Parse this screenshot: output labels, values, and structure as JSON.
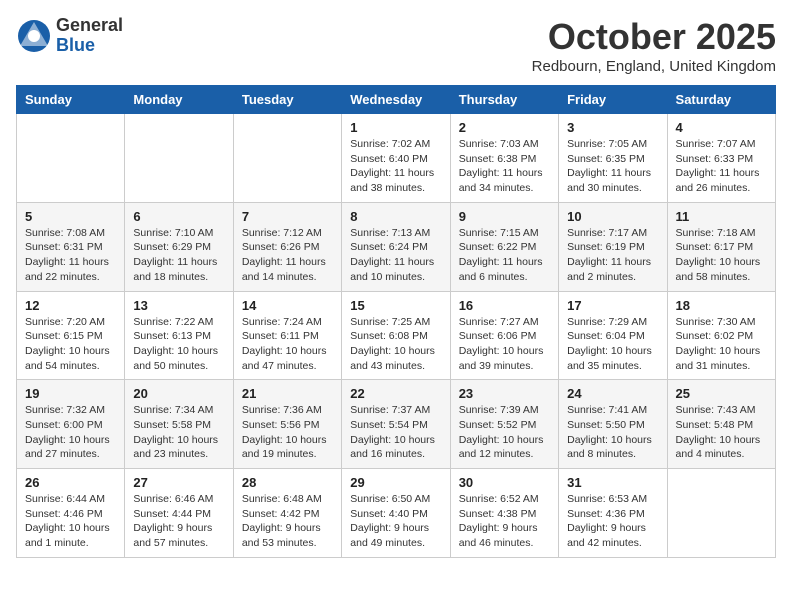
{
  "logo": {
    "general": "General",
    "blue": "Blue"
  },
  "title": "October 2025",
  "location": "Redbourn, England, United Kingdom",
  "days_of_week": [
    "Sunday",
    "Monday",
    "Tuesday",
    "Wednesday",
    "Thursday",
    "Friday",
    "Saturday"
  ],
  "weeks": [
    [
      {
        "day": "",
        "info": ""
      },
      {
        "day": "",
        "info": ""
      },
      {
        "day": "",
        "info": ""
      },
      {
        "day": "1",
        "info": "Sunrise: 7:02 AM\nSunset: 6:40 PM\nDaylight: 11 hours\nand 38 minutes."
      },
      {
        "day": "2",
        "info": "Sunrise: 7:03 AM\nSunset: 6:38 PM\nDaylight: 11 hours\nand 34 minutes."
      },
      {
        "day": "3",
        "info": "Sunrise: 7:05 AM\nSunset: 6:35 PM\nDaylight: 11 hours\nand 30 minutes."
      },
      {
        "day": "4",
        "info": "Sunrise: 7:07 AM\nSunset: 6:33 PM\nDaylight: 11 hours\nand 26 minutes."
      }
    ],
    [
      {
        "day": "5",
        "info": "Sunrise: 7:08 AM\nSunset: 6:31 PM\nDaylight: 11 hours\nand 22 minutes."
      },
      {
        "day": "6",
        "info": "Sunrise: 7:10 AM\nSunset: 6:29 PM\nDaylight: 11 hours\nand 18 minutes."
      },
      {
        "day": "7",
        "info": "Sunrise: 7:12 AM\nSunset: 6:26 PM\nDaylight: 11 hours\nand 14 minutes."
      },
      {
        "day": "8",
        "info": "Sunrise: 7:13 AM\nSunset: 6:24 PM\nDaylight: 11 hours\nand 10 minutes."
      },
      {
        "day": "9",
        "info": "Sunrise: 7:15 AM\nSunset: 6:22 PM\nDaylight: 11 hours\nand 6 minutes."
      },
      {
        "day": "10",
        "info": "Sunrise: 7:17 AM\nSunset: 6:19 PM\nDaylight: 11 hours\nand 2 minutes."
      },
      {
        "day": "11",
        "info": "Sunrise: 7:18 AM\nSunset: 6:17 PM\nDaylight: 10 hours\nand 58 minutes."
      }
    ],
    [
      {
        "day": "12",
        "info": "Sunrise: 7:20 AM\nSunset: 6:15 PM\nDaylight: 10 hours\nand 54 minutes."
      },
      {
        "day": "13",
        "info": "Sunrise: 7:22 AM\nSunset: 6:13 PM\nDaylight: 10 hours\nand 50 minutes."
      },
      {
        "day": "14",
        "info": "Sunrise: 7:24 AM\nSunset: 6:11 PM\nDaylight: 10 hours\nand 47 minutes."
      },
      {
        "day": "15",
        "info": "Sunrise: 7:25 AM\nSunset: 6:08 PM\nDaylight: 10 hours\nand 43 minutes."
      },
      {
        "day": "16",
        "info": "Sunrise: 7:27 AM\nSunset: 6:06 PM\nDaylight: 10 hours\nand 39 minutes."
      },
      {
        "day": "17",
        "info": "Sunrise: 7:29 AM\nSunset: 6:04 PM\nDaylight: 10 hours\nand 35 minutes."
      },
      {
        "day": "18",
        "info": "Sunrise: 7:30 AM\nSunset: 6:02 PM\nDaylight: 10 hours\nand 31 minutes."
      }
    ],
    [
      {
        "day": "19",
        "info": "Sunrise: 7:32 AM\nSunset: 6:00 PM\nDaylight: 10 hours\nand 27 minutes."
      },
      {
        "day": "20",
        "info": "Sunrise: 7:34 AM\nSunset: 5:58 PM\nDaylight: 10 hours\nand 23 minutes."
      },
      {
        "day": "21",
        "info": "Sunrise: 7:36 AM\nSunset: 5:56 PM\nDaylight: 10 hours\nand 19 minutes."
      },
      {
        "day": "22",
        "info": "Sunrise: 7:37 AM\nSunset: 5:54 PM\nDaylight: 10 hours\nand 16 minutes."
      },
      {
        "day": "23",
        "info": "Sunrise: 7:39 AM\nSunset: 5:52 PM\nDaylight: 10 hours\nand 12 minutes."
      },
      {
        "day": "24",
        "info": "Sunrise: 7:41 AM\nSunset: 5:50 PM\nDaylight: 10 hours\nand 8 minutes."
      },
      {
        "day": "25",
        "info": "Sunrise: 7:43 AM\nSunset: 5:48 PM\nDaylight: 10 hours\nand 4 minutes."
      }
    ],
    [
      {
        "day": "26",
        "info": "Sunrise: 6:44 AM\nSunset: 4:46 PM\nDaylight: 10 hours\nand 1 minute."
      },
      {
        "day": "27",
        "info": "Sunrise: 6:46 AM\nSunset: 4:44 PM\nDaylight: 9 hours\nand 57 minutes."
      },
      {
        "day": "28",
        "info": "Sunrise: 6:48 AM\nSunset: 4:42 PM\nDaylight: 9 hours\nand 53 minutes."
      },
      {
        "day": "29",
        "info": "Sunrise: 6:50 AM\nSunset: 4:40 PM\nDaylight: 9 hours\nand 49 minutes."
      },
      {
        "day": "30",
        "info": "Sunrise: 6:52 AM\nSunset: 4:38 PM\nDaylight: 9 hours\nand 46 minutes."
      },
      {
        "day": "31",
        "info": "Sunrise: 6:53 AM\nSunset: 4:36 PM\nDaylight: 9 hours\nand 42 minutes."
      },
      {
        "day": "",
        "info": ""
      }
    ]
  ]
}
